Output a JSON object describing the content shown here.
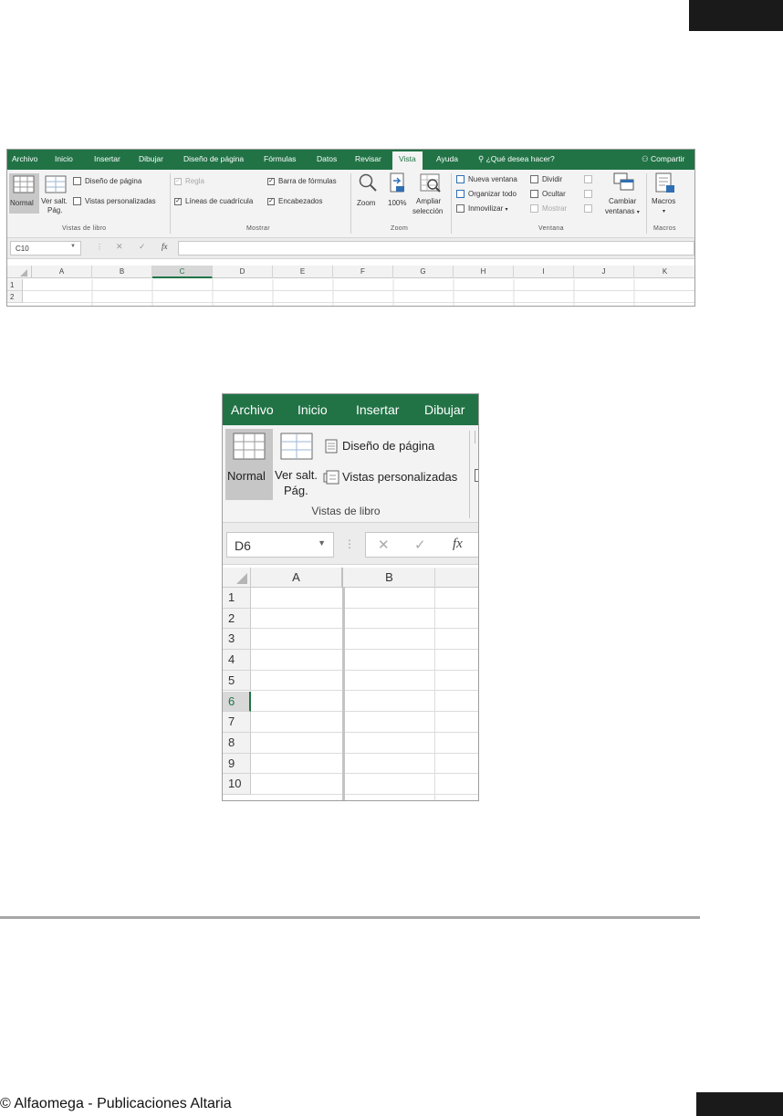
{
  "ribbon_full": {
    "tabs": [
      "Archivo",
      "Inicio",
      "Insertar",
      "Dibujar",
      "Diseño de página",
      "Fórmulas",
      "Datos",
      "Revisar",
      "Vista",
      "Ayuda"
    ],
    "active_tab": "Vista",
    "search": "¿Qué desea hacer?",
    "share": "Compartir",
    "groups": {
      "vistas": {
        "label": "Vistas de libro",
        "normal": "Normal",
        "ver_salt_1": "Ver salt.",
        "ver_salt_2": "Pág.",
        "diseno": "Diseño de página",
        "personalizadas": "Vistas personalizadas"
      },
      "mostrar": {
        "label": "Mostrar",
        "regla": "Regla",
        "lineas": "Líneas de cuadrícula",
        "barra": "Barra de fórmulas",
        "encabezados": "Encabezados"
      },
      "zoom": {
        "label": "Zoom",
        "zoom": "Zoom",
        "cien": "100%",
        "ampliar_1": "Ampliar",
        "ampliar_2": "selección"
      },
      "ventana": {
        "label": "Ventana",
        "nueva": "Nueva ventana",
        "organizar": "Organizar todo",
        "inmovilizar": "Inmovilizar",
        "dividir": "Dividir",
        "ocultar": "Ocultar",
        "mostrar": "Mostrar",
        "cambiar_1": "Cambiar",
        "cambiar_2": "ventanas"
      },
      "macros": {
        "label": "Macros",
        "macros": "Macros"
      }
    },
    "name_box": "C10",
    "fx": "fx",
    "columns": [
      "A",
      "B",
      "C",
      "D",
      "E",
      "F",
      "G",
      "H",
      "I",
      "J",
      "K"
    ],
    "selected_column": "C",
    "rows": [
      "1",
      "2"
    ]
  },
  "ribbon_zoom": {
    "tabs": [
      "Archivo",
      "Inicio",
      "Insertar",
      "Dibujar"
    ],
    "normal": "Normal",
    "ver_salt_1": "Ver salt.",
    "ver_salt_2": "Pág.",
    "diseno": "Diseño de página",
    "personalizadas": "Vistas personalizadas",
    "group_label": "Vistas de libro",
    "name_box": "D6",
    "fx": "fx",
    "columns": [
      "A",
      "B"
    ],
    "rows": [
      "1",
      "2",
      "3",
      "4",
      "5",
      "6",
      "7",
      "8",
      "9",
      "10"
    ],
    "selected_row": "6"
  },
  "footer": "© Alfaomega - Publicaciones Altaria"
}
